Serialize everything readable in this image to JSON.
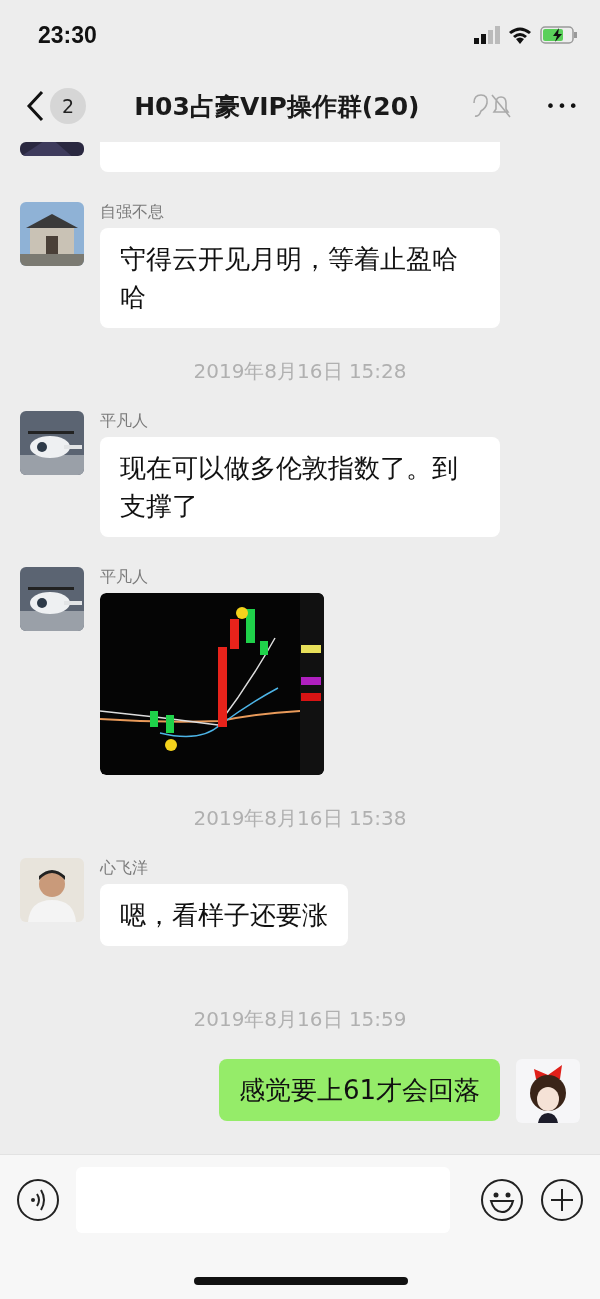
{
  "status_bar": {
    "time": "23:30"
  },
  "header": {
    "unread": "2",
    "title": "H03占豪VIP操作群(20)",
    "more": "•••"
  },
  "messages": [
    {
      "kind": "cut"
    },
    {
      "kind": "text",
      "sender": "自强不息",
      "text": "守得云开见月明，等着止盈哈哈"
    },
    {
      "kind": "time",
      "text": "2019年8月16日 15:28"
    },
    {
      "kind": "text",
      "sender": "平凡人",
      "text": "现在可以做多伦敦指数了。到支撑了"
    },
    {
      "sender": "平凡人"
    },
    {
      "kind": "time",
      "text": "2019年8月16日 15:38"
    },
    {
      "kind": "text",
      "sender": "心飞洋",
      "text": "嗯，看样子还要涨"
    },
    {
      "kind": "time",
      "text": "2019年8月16日 15:59"
    },
    {
      "kind": "own",
      "text": "感觉要上61才会回落"
    }
  ]
}
